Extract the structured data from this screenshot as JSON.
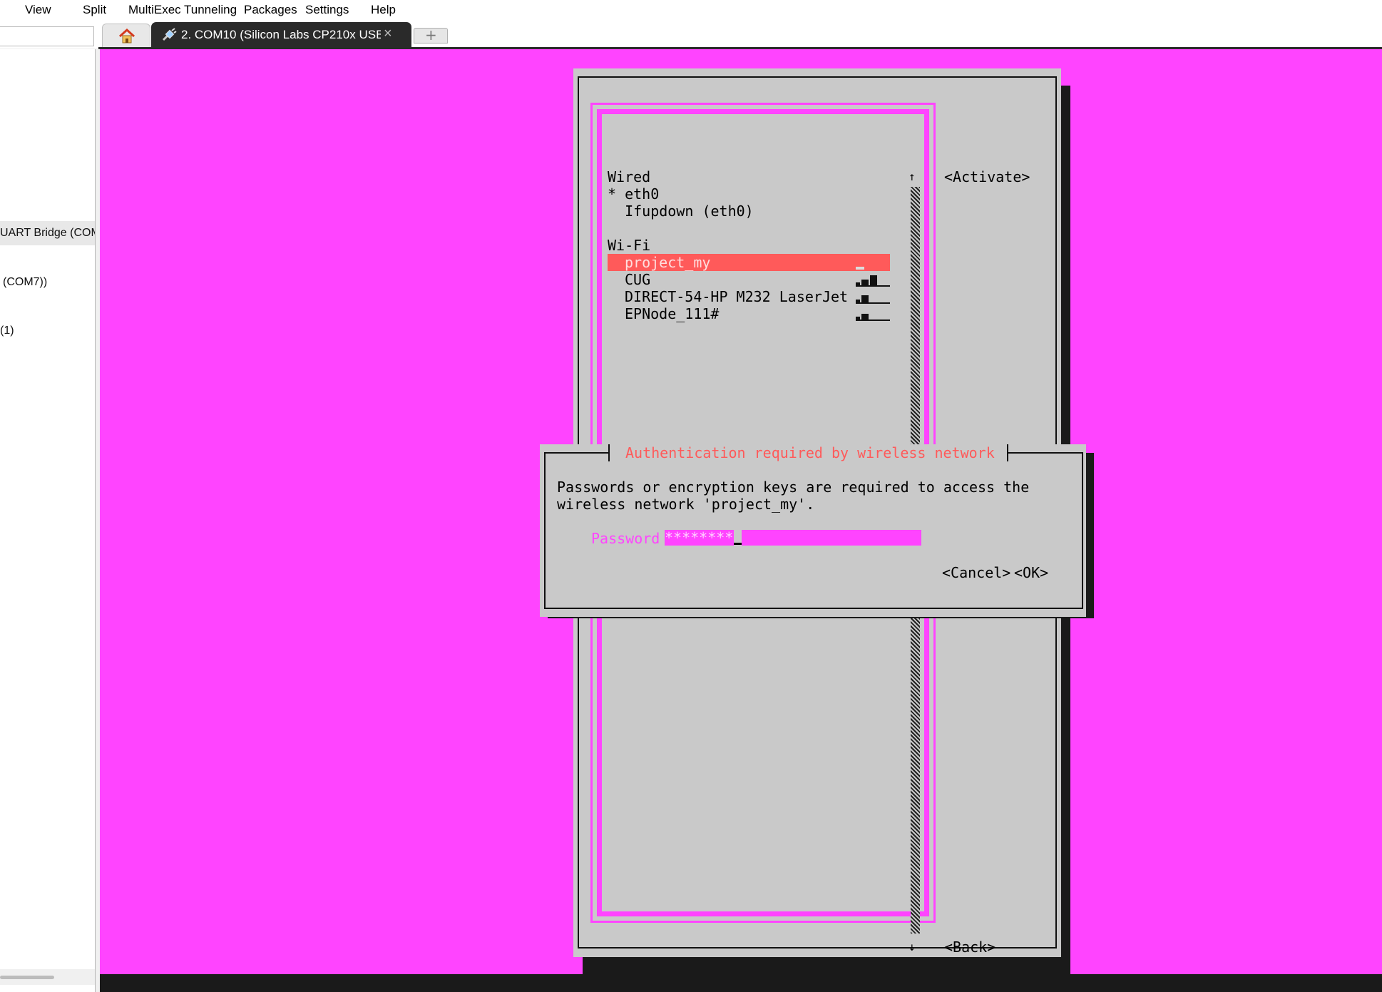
{
  "menu": {
    "view": "View",
    "split": "Split",
    "multiexec": "MultiExec",
    "tunneling": "Tunneling",
    "packages": "Packages",
    "settings": "Settings",
    "help": "Help"
  },
  "tabs": {
    "active_label": "2. COM10  (Silicon Labs CP210x USB",
    "close_glyph": "×",
    "new_tab_glyph": "+"
  },
  "sidebar": {
    "items": [
      "UART Bridge (COM",
      "(COM7))",
      "(1)"
    ]
  },
  "nmtui": {
    "wired_header": "Wired",
    "eth0": "* eth0",
    "ifupdown": "  Ifupdown (eth0)",
    "wifi_header": "Wi-Fi",
    "networks": [
      {
        "ssid": "project_my",
        "signal_bars": 1,
        "selected": true
      },
      {
        "ssid": "CUG",
        "signal_bars": 3,
        "selected": false
      },
      {
        "ssid": "DIRECT-54-HP M232 LaserJet",
        "signal_bars": 2,
        "selected": false
      },
      {
        "ssid": "EPNode_111#",
        "signal_bars": 2,
        "selected": false
      }
    ],
    "activate_button": "<Activate>",
    "back_button": "<Back>",
    "scroll_up": "↑",
    "scroll_down": "↓"
  },
  "auth_dialog": {
    "title": "Authentication required by wireless network",
    "message_line1": "Passwords or encryption keys are required to access the",
    "message_line2": "wireless network 'project_my'.",
    "password_label": "Password",
    "password_value": "********",
    "cancel_button": "<Cancel>",
    "ok_button": "<OK>"
  },
  "colors": {
    "terminal_bg": "#ff44ff",
    "window_bg": "#c9c9c9",
    "selection": "#ff5a5a",
    "shadow": "#1a1a1a"
  }
}
